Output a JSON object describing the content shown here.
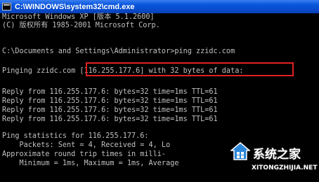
{
  "window": {
    "title": "C:\\WINDOWS\\system32\\cmd.exe"
  },
  "console": {
    "lines": [
      "Microsoft Windows XP [版本 5.1.2600]",
      "(C) 版权所有 1985-2001 Microsoft Corp.",
      "",
      "C:\\Documents and Settings\\Administrator>ping zzidc.com",
      "",
      "Pinging zzidc.com [116.255.177.6] with 32 bytes of data:",
      "",
      "Reply from 116.255.177.6: bytes=32 time=1ms TTL=61",
      "Reply from 116.255.177.6: bytes=32 time=1ms TTL=61",
      "Reply from 116.255.177.6: bytes=32 time=1ms TTL=61",
      "Reply from 116.255.177.6: bytes=32 time=1ms TTL=61",
      "",
      "Ping statistics for 116.255.177.6:",
      "    Packets: Sent = 4, Received = 4, Lo",
      "Approximate round trip times in milli-",
      "    Minimum = 1ms, Maximum = 1ms, Average"
    ]
  },
  "watermark": {
    "brand": "系统之家",
    "url": "XITONGZHIJIA.NET"
  },
  "colors": {
    "console_text": "#c0c0c0",
    "console_bg": "#000000",
    "titlebar": "#0a56dc",
    "highlight": "#e02020"
  }
}
